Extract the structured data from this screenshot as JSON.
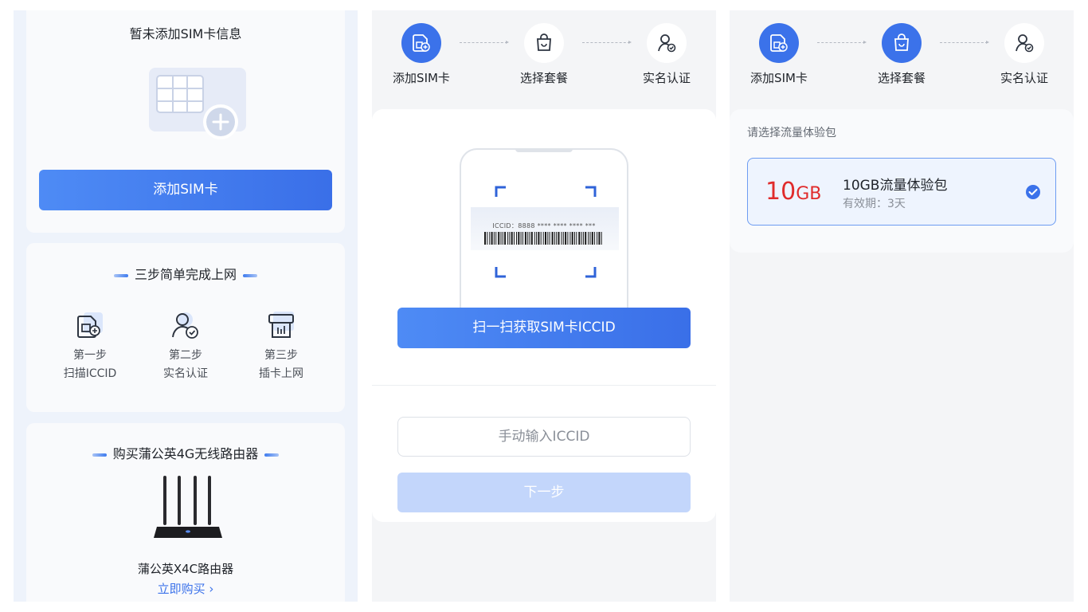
{
  "panel1": {
    "empty_title": "暂未添加SIM卡信息",
    "add_button": "添加SIM卡",
    "steps_title": "三步简单完成上网",
    "steps": [
      {
        "line1": "第一步",
        "line2": "扫描ICCID",
        "icon": "sim-add-icon"
      },
      {
        "line1": "第二步",
        "line2": "实名认证",
        "icon": "user-verified-icon"
      },
      {
        "line1": "第三步",
        "line2": "插卡上网",
        "icon": "sim-insert-icon"
      }
    ],
    "buy_title": "购买蒲公英4G无线路由器",
    "product_name": "蒲公英X4C路由器",
    "buy_link": "立即购买 ›"
  },
  "stepper": {
    "steps": [
      "添加SIM卡",
      "选择套餐",
      "实名认证"
    ]
  },
  "panel2": {
    "iccid_text": "ICCID：8888 **** **** **** ***",
    "scan_button": "扫一扫获取SIM卡ICCID",
    "manual_placeholder": "手动输入ICCID",
    "next_button": "下一步"
  },
  "panel3": {
    "section_label": "请选择流量体验包",
    "package": {
      "size_number": "10",
      "size_unit": "GB",
      "name": "10GB流量体验包",
      "validity": "有效期：3天",
      "selected": true
    }
  },
  "colors": {
    "accent": "#3b72ea",
    "price_red": "#e02b2b",
    "disabled": "#c3d6fb"
  }
}
